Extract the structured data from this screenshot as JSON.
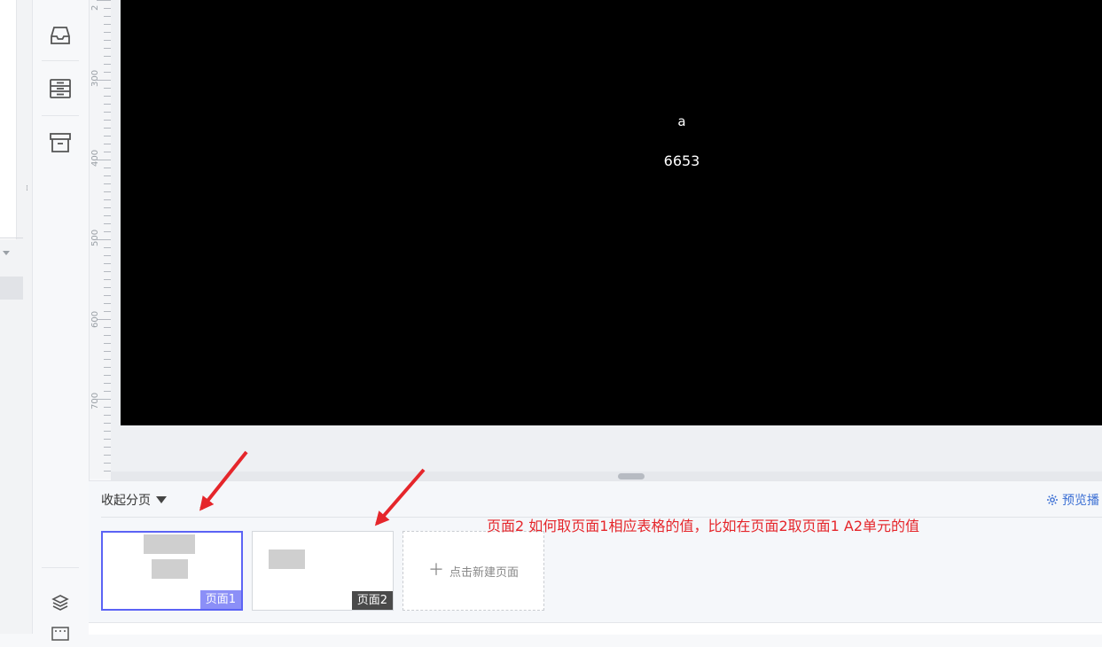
{
  "canvas": {
    "text_top": "a",
    "text_value": "6653"
  },
  "ruler": {
    "ticks": [
      "2",
      "300",
      "400",
      "500",
      "600",
      "700"
    ]
  },
  "pages_panel": {
    "collapse_label": "收起分页",
    "preview_label": "预览播",
    "pages": [
      {
        "label": "页面1",
        "active": true
      },
      {
        "label": "页面2",
        "active": false
      }
    ],
    "new_page_label": "点击新建页面"
  },
  "annotation": {
    "text": "页面2 如何取页面1相应表格的值，比如在页面2取页面1 A2单元的值"
  },
  "colors": {
    "canvas_bg": "#000000",
    "active_page_border": "#5b63f5",
    "annotation": "#e5262b",
    "link": "#3b6fd4"
  },
  "icons": [
    "inbox-icon",
    "storage-icon",
    "archive-icon",
    "layers-icon",
    "keyboard-icon",
    "gear-icon",
    "plus-icon",
    "arrow-icon"
  ]
}
